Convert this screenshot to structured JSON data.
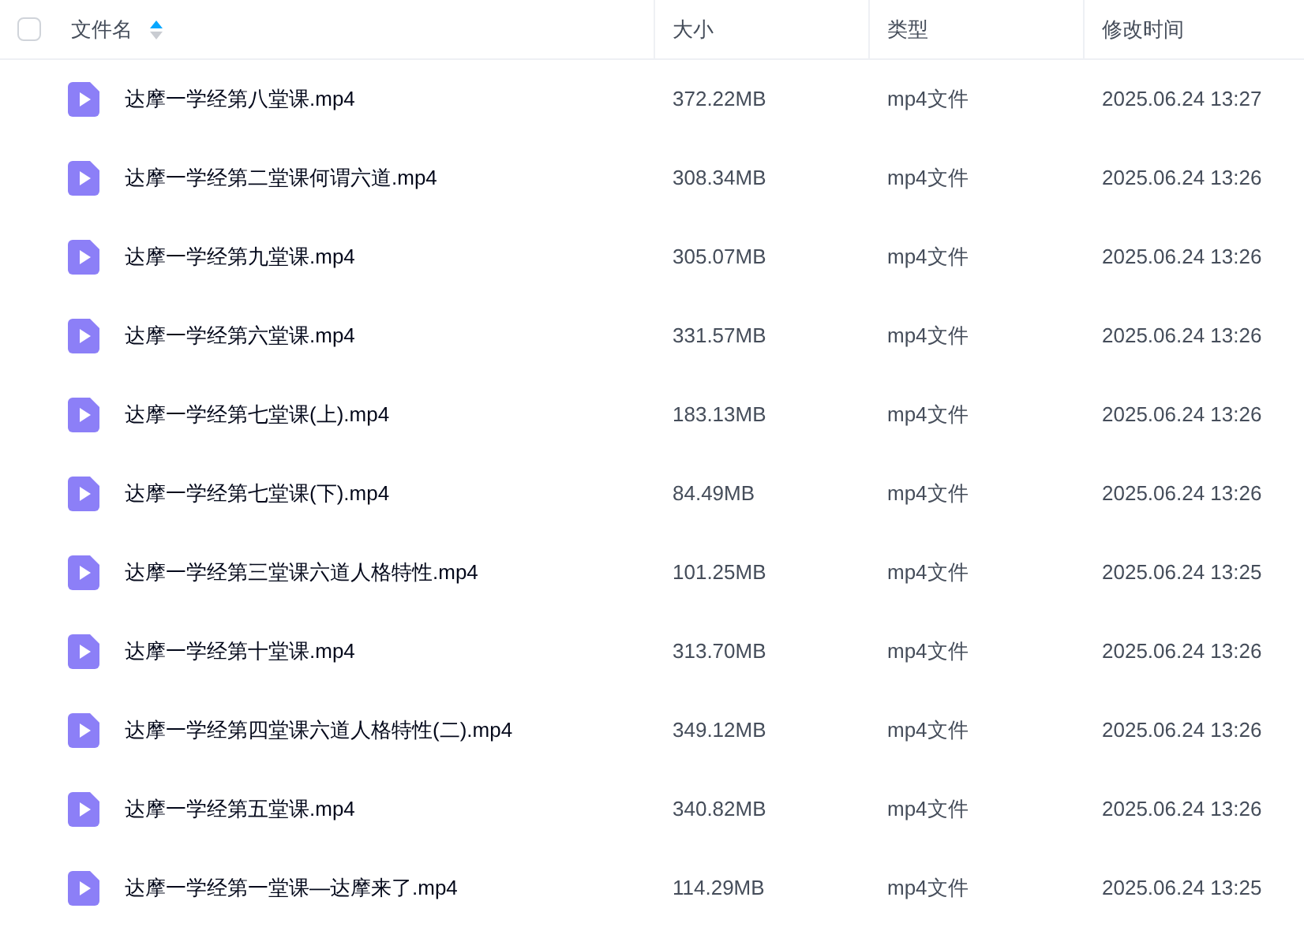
{
  "header": {
    "checkbox": {
      "checked": false
    },
    "columns": [
      {
        "label": "文件名",
        "sorted": true
      },
      {
        "label": "大小",
        "sorted": false
      },
      {
        "label": "类型",
        "sorted": false
      },
      {
        "label": "修改时间",
        "sorted": false
      }
    ]
  },
  "rows": [
    {
      "name": "达摩一学经第八堂课.mp4",
      "size": "372.22MB",
      "type": "mp4文件",
      "modified": "2025.06.24 13:27"
    },
    {
      "name": "达摩一学经第二堂课何谓六道.mp4",
      "size": "308.34MB",
      "type": "mp4文件",
      "modified": "2025.06.24 13:26"
    },
    {
      "name": "达摩一学经第九堂课.mp4",
      "size": "305.07MB",
      "type": "mp4文件",
      "modified": "2025.06.24 13:26"
    },
    {
      "name": "达摩一学经第六堂课.mp4",
      "size": "331.57MB",
      "type": "mp4文件",
      "modified": "2025.06.24 13:26"
    },
    {
      "name": "达摩一学经第七堂课(上).mp4",
      "size": "183.13MB",
      "type": "mp4文件",
      "modified": "2025.06.24 13:26"
    },
    {
      "name": "达摩一学经第七堂课(下).mp4",
      "size": "84.49MB",
      "type": "mp4文件",
      "modified": "2025.06.24 13:26"
    },
    {
      "name": "达摩一学经第三堂课六道人格特性.mp4",
      "size": "101.25MB",
      "type": "mp4文件",
      "modified": "2025.06.24 13:25"
    },
    {
      "name": "达摩一学经第十堂课.mp4",
      "size": "313.70MB",
      "type": "mp4文件",
      "modified": "2025.06.24 13:26"
    },
    {
      "name": "达摩一学经第四堂课六道人格特性(二).mp4",
      "size": "349.12MB",
      "type": "mp4文件",
      "modified": "2025.06.24 13:26"
    },
    {
      "name": "达摩一学经第五堂课.mp4",
      "size": "340.82MB",
      "type": "mp4文件",
      "modified": "2025.06.24 13:26"
    },
    {
      "name": "达摩一学经第一堂课—达摩来了.mp4",
      "size": "114.29MB",
      "type": "mp4文件",
      "modified": "2025.06.24 13:25"
    }
  ]
}
